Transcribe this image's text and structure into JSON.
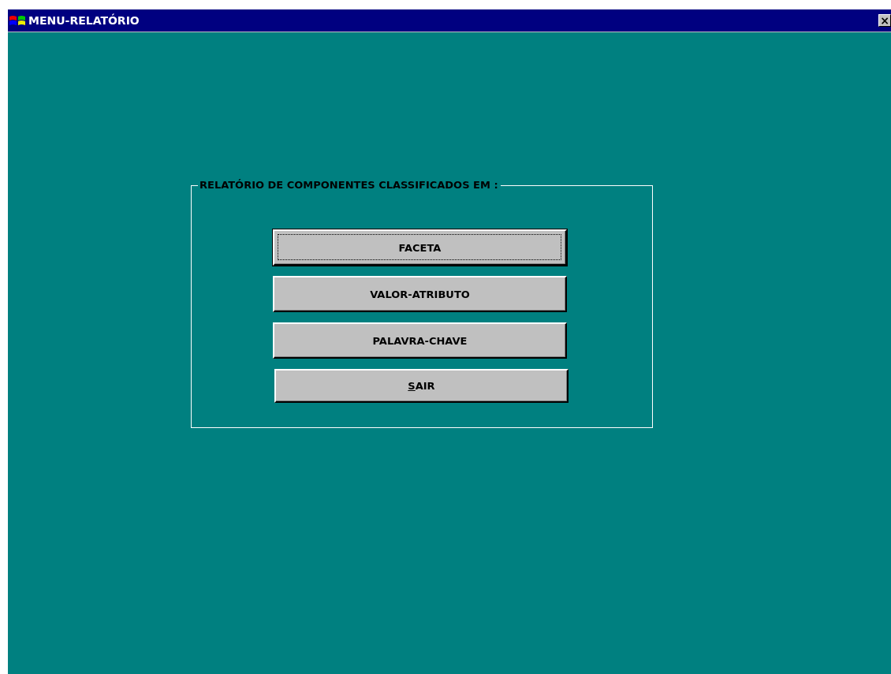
{
  "window": {
    "title": "MENU-RELATÓRIO",
    "close_label": "×"
  },
  "group": {
    "label": "RELATÓRIO DE COMPONENTES CLASSIFICADOS EM :",
    "buttons": [
      {
        "label": "FACETA",
        "focused": true,
        "underline_first": false
      },
      {
        "label": "VALOR-ATRIBUTO",
        "focused": false,
        "underline_first": false
      },
      {
        "label": "PALAVRA-CHAVE",
        "focused": false,
        "underline_first": false
      },
      {
        "label": "SAIR",
        "focused": false,
        "underline_first": true
      }
    ]
  }
}
